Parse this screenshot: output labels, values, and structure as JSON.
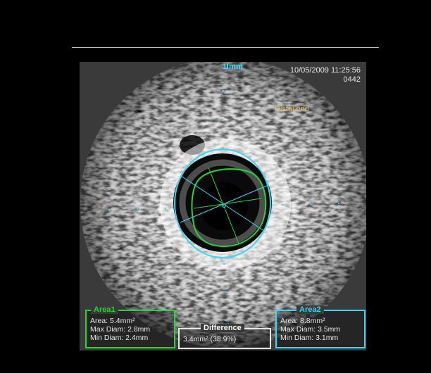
{
  "overlay": {
    "scale_label": "1 mm",
    "date_time": "10/05/2009 11:25:56",
    "frame": "0442",
    "region_label": "Distal end"
  },
  "area1": {
    "title": "Area1",
    "area": "Area: 5.4mm²",
    "max_diam": "Max Diam: 2.8mm",
    "min_diam": "Min Diam: 2.4mm",
    "color": "#22d636"
  },
  "area2": {
    "title": "Area2",
    "area": "Area: 8.8mm²",
    "max_diam": "Max Diam: 3.5mm",
    "min_diam": "Min Diam: 3.1mm",
    "color": "#39d8f0"
  },
  "difference": {
    "title": "Difference",
    "value": "3.4mm² (38.9%)"
  }
}
